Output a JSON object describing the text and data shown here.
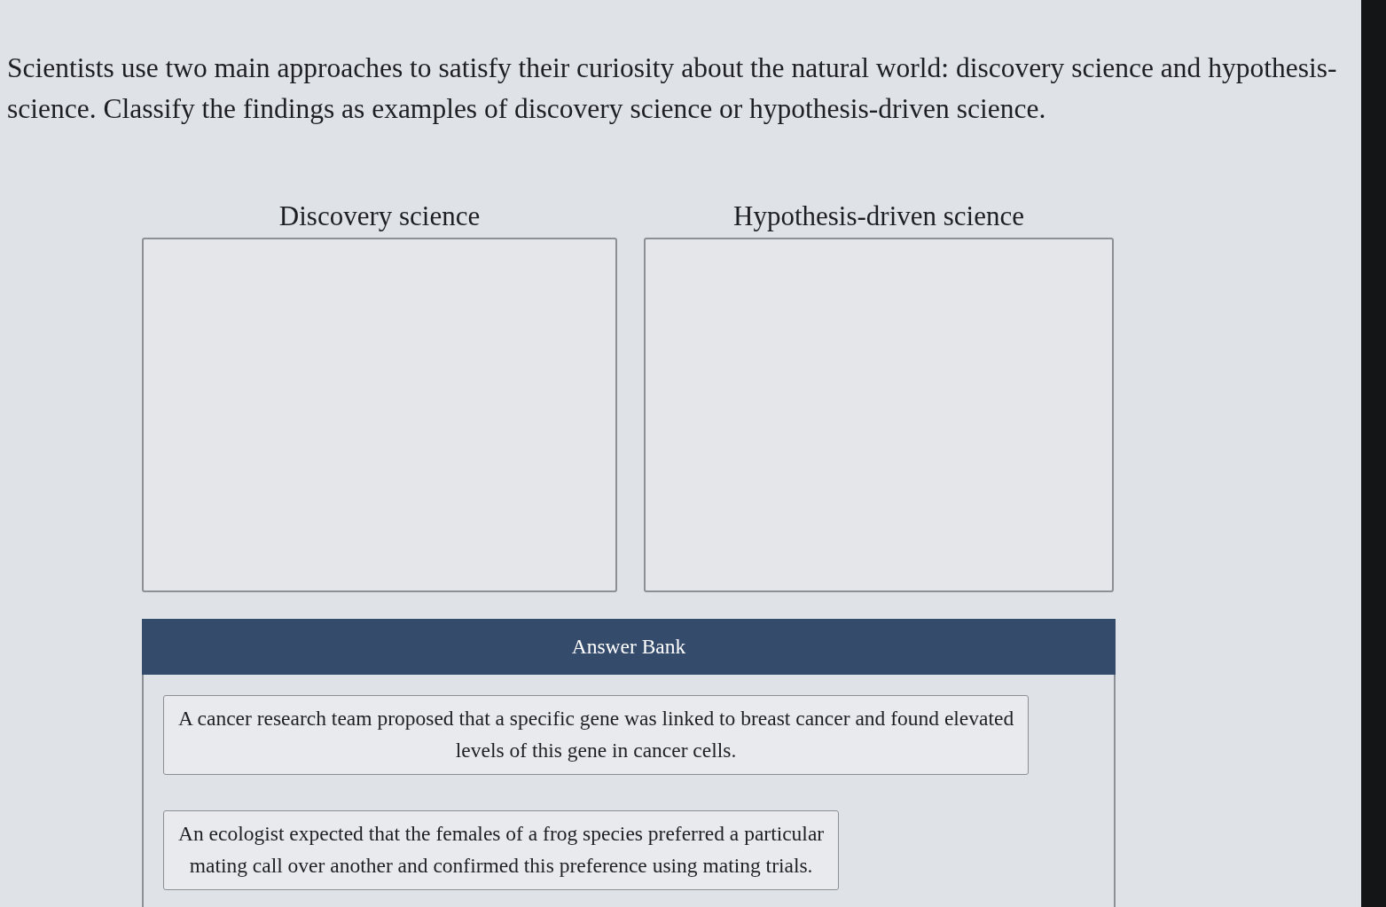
{
  "prompt": {
    "lines": [
      "Scientists use two main approaches to satisfy their curiosity about the natural world: discovery science and hypothesis-",
      "science. Classify the findings as examples of discovery science or hypothesis-driven science."
    ]
  },
  "categories": [
    {
      "heading": "Discovery science"
    },
    {
      "heading": "Hypothesis-driven science"
    }
  ],
  "answer_bank": {
    "title": "Answer Bank",
    "items": [
      {
        "lines": [
          "A cancer research team proposed that a specific gene was linked to breast cancer and found elevated",
          "levels of this gene in cancer cells."
        ]
      },
      {
        "lines": [
          "An ecologist expected that the females of a frog species preferred a particular",
          "mating call over another and confirmed this preference using mating trials."
        ]
      }
    ]
  }
}
